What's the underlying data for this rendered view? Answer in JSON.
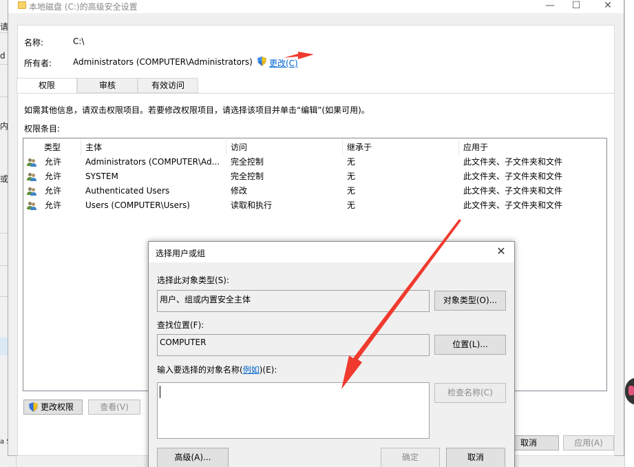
{
  "background": {
    "left_chars": [
      "请",
      "d",
      "内",
      "或",
      "a S"
    ]
  },
  "window": {
    "title": "本地磁盘 (C:)的高级安全设置",
    "controls": {
      "minimize": "—",
      "maximize": "☐",
      "close": "✕"
    }
  },
  "info": {
    "name_label": "名称:",
    "name_value": "C:\\",
    "owner_label": "所有者:",
    "owner_value": "Administrators (COMPUTER\\Administrators)",
    "change_link": "更改(C)"
  },
  "tabs": [
    {
      "label": "权限",
      "active": true
    },
    {
      "label": "审核",
      "active": false
    },
    {
      "label": "有效访问",
      "active": false
    }
  ],
  "hint": "如需其他信息，请双击权限项目。若要修改权限项目，请选择该项目并单击“编辑”(如果可用)。",
  "entries_label": "权限条目:",
  "table": {
    "headers": [
      "类型",
      "主体",
      "访问",
      "继承于",
      "应用于"
    ],
    "rows": [
      [
        "允许",
        "Administrators (COMPUTER\\Ad...",
        "完全控制",
        "无",
        "此文件夹、子文件夹和文件"
      ],
      [
        "允许",
        "SYSTEM",
        "完全控制",
        "无",
        "此文件夹、子文件夹和文件"
      ],
      [
        "允许",
        "Authenticated Users",
        "修改",
        "无",
        "此文件夹、子文件夹和文件"
      ],
      [
        "允许",
        "Users (COMPUTER\\Users)",
        "读取和执行",
        "无",
        "此文件夹、子文件夹和文件"
      ]
    ]
  },
  "buttons": {
    "change_perms": "更改权限",
    "view": "查看(V)",
    "cancel": "取消",
    "apply": "应用(A)"
  },
  "dialog": {
    "title": "选择用户或组",
    "close": "✕",
    "object_type_label": "选择此对象类型(S):",
    "object_type_value": "用户、组或内置安全主体",
    "object_type_button": "对象类型(O)...",
    "location_label": "查找位置(F):",
    "location_value": "COMPUTER",
    "location_button": "位置(L)...",
    "names_label_prefix": "输入要选择的对象名称(",
    "names_label_link": "例如",
    "names_label_suffix": ")(E):",
    "names_value": "",
    "check_names": "检查名称(C)",
    "advanced": "高级(A)...",
    "ok": "确定",
    "cancel": "取消"
  },
  "colors": {
    "arrow": "#f03a2e",
    "link": "#0066cc"
  }
}
